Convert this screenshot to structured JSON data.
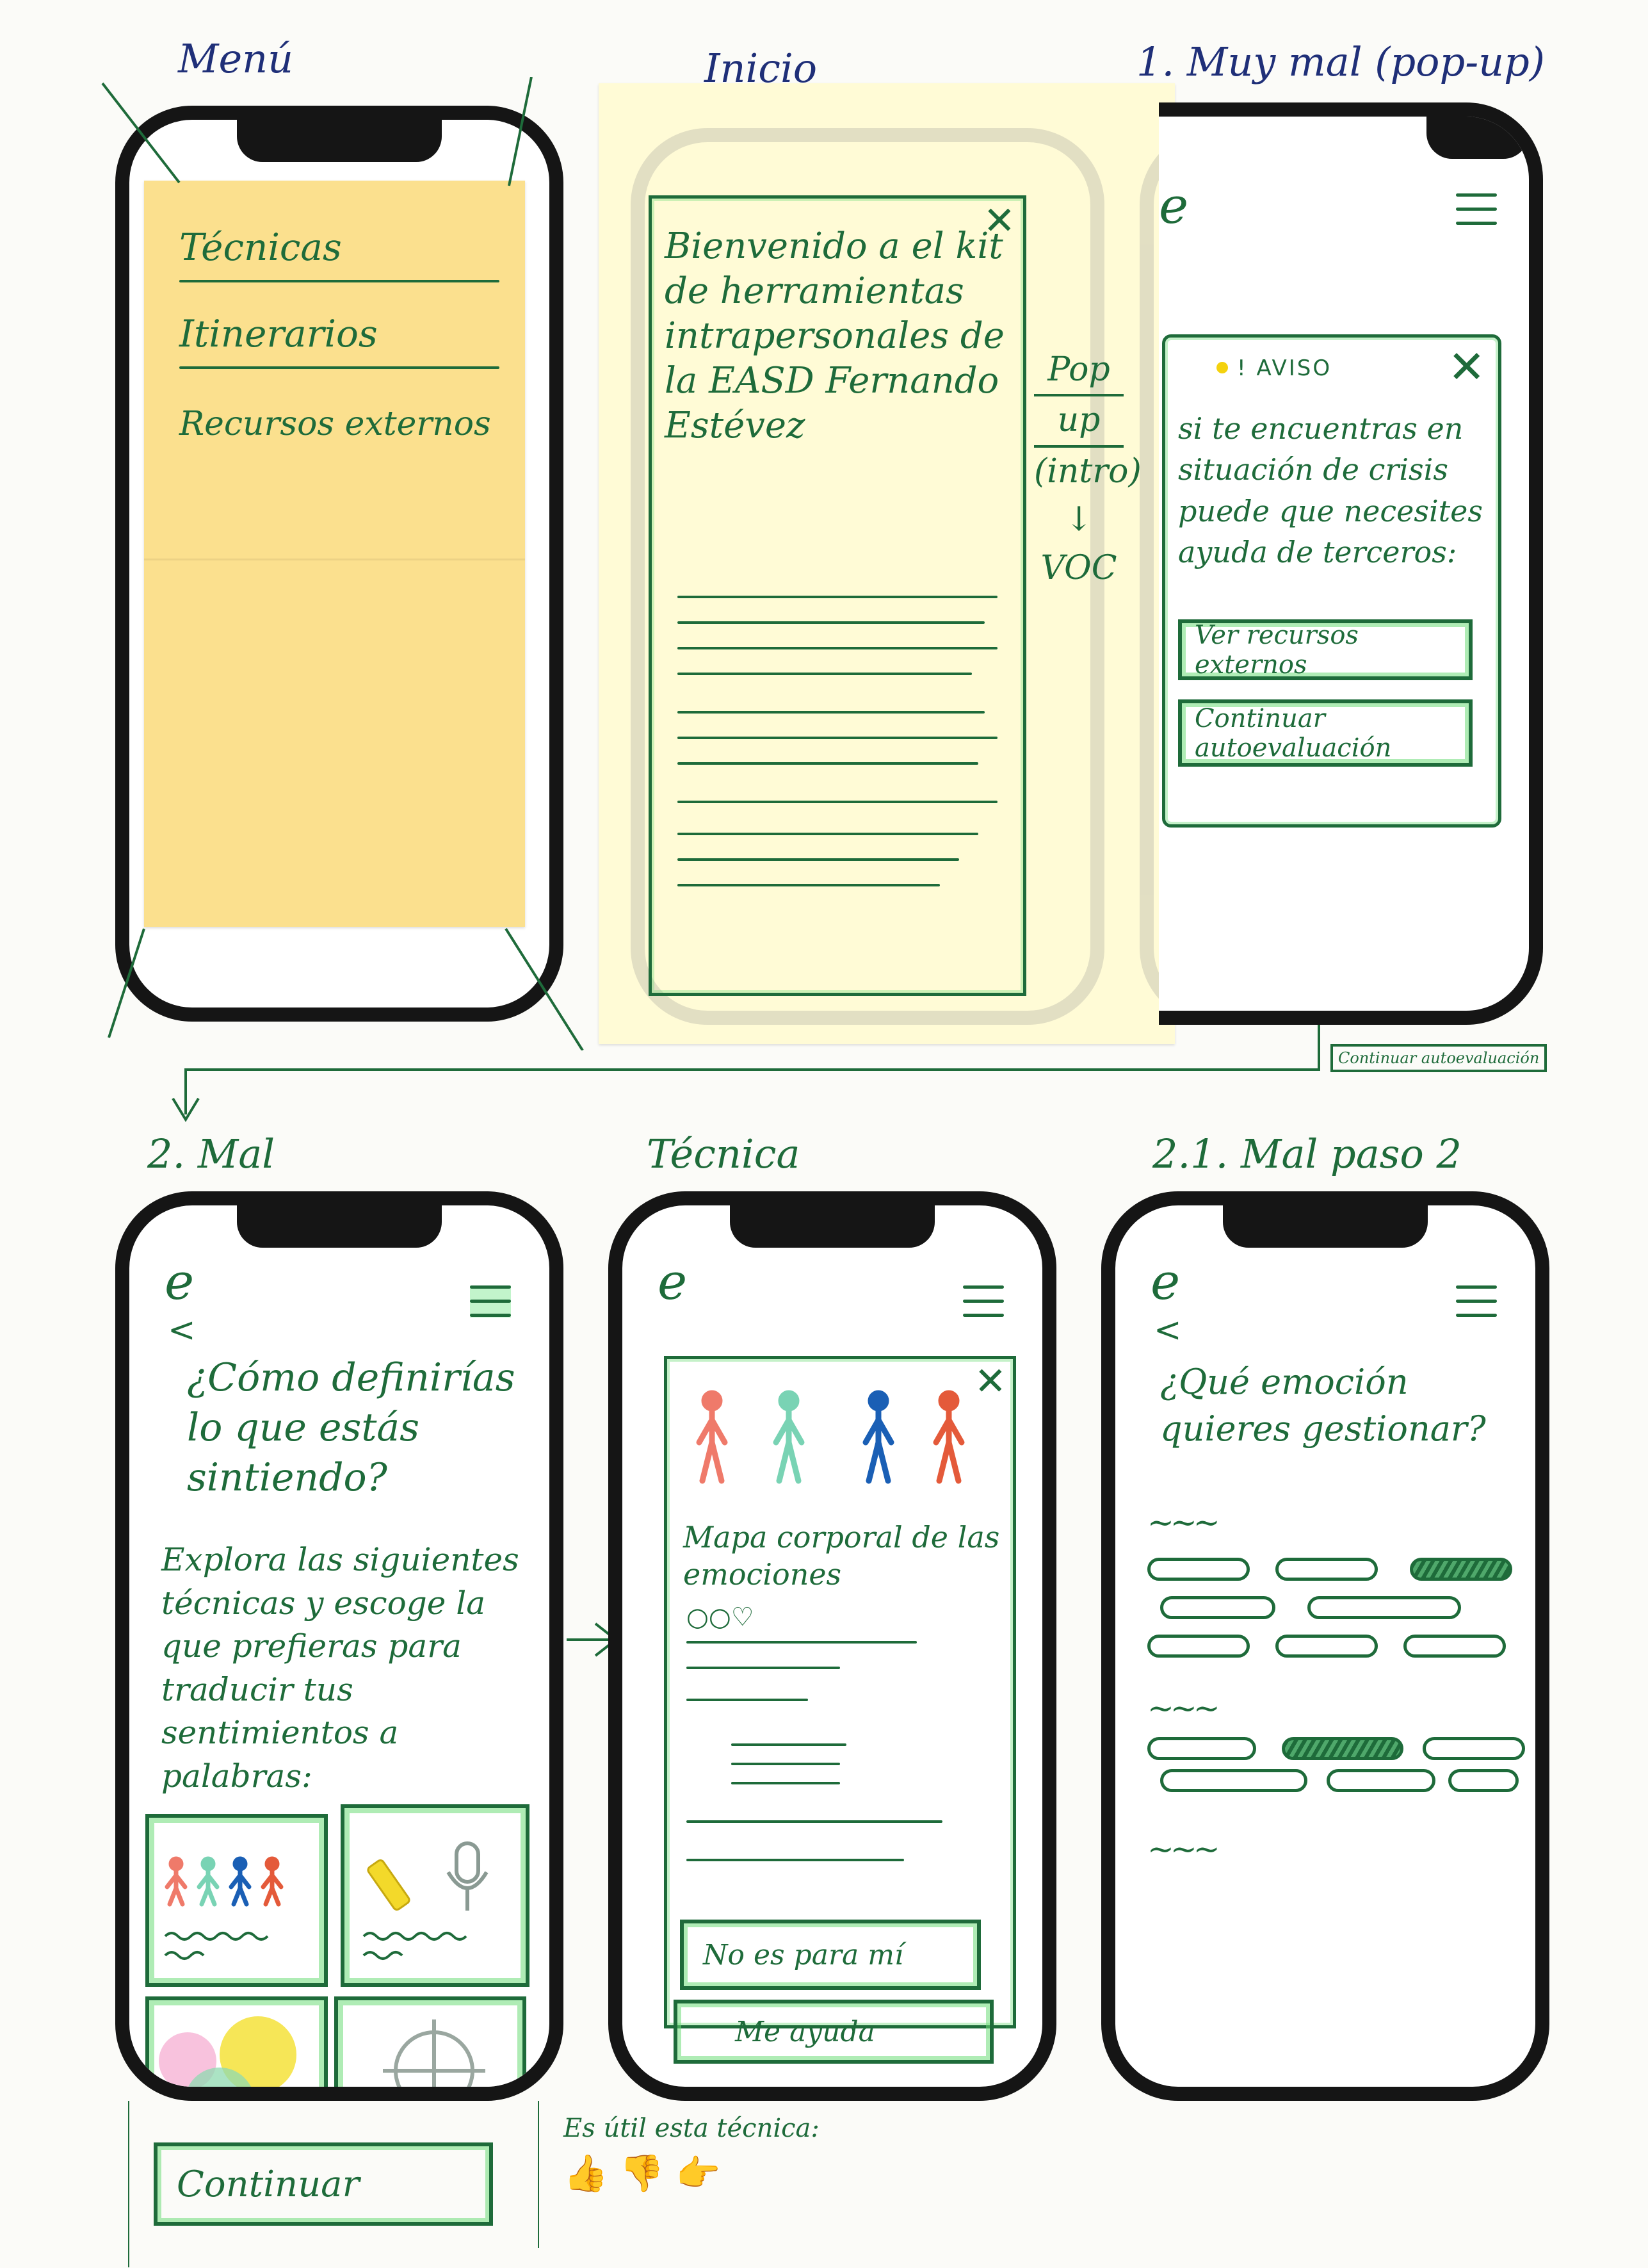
{
  "screens": {
    "menu": {
      "title": "Menú",
      "items": [
        "Técnicas",
        "Itinerarios",
        "Recursos externos"
      ]
    },
    "inicio": {
      "title": "Inicio",
      "popup_text": "Bienvenido a el kit de herramientas intrapersonales de la EASD Fernando Estévez",
      "side_note": [
        "Pop",
        "up",
        "(intro)",
        "↓",
        "VOC"
      ]
    },
    "muy_mal": {
      "title": "1. Muy mal (pop-up)",
      "logo": "e",
      "aviso_label": "! AVISO",
      "aviso_text": "si te encuentras en situación de crisis puede que necesites ayuda de terceros:",
      "btn_recursos": "Ver recursos externos",
      "btn_continuar": "Continuar autoevaluación",
      "flow_tag": "Continuar autoevaluación"
    },
    "mal": {
      "title": "2. Mal",
      "logo": "e",
      "back": "<",
      "question": "¿Cómo definirías lo que estás sintiendo?",
      "body": "Explora las siguientes técnicas y escoge la que prefieras para traducir tus sentimientos a palabras:",
      "continue_btn": "Continuar"
    },
    "tecnica": {
      "title": "Técnica",
      "logo": "e",
      "card_title": "Mapa corporal de las emociones",
      "rating": "○○♡",
      "btn_no": "No es para mí",
      "btn_yes": "Me ayuda",
      "feedback_label": "Es útil esta técnica:"
    },
    "mal_paso2": {
      "title": "2.1. Mal paso 2",
      "logo": "e",
      "back": "<",
      "question": "¿Qué emoción quieres gestionar?"
    }
  },
  "colors": {
    "ink_green": "#1e6b3a",
    "ink_navy": "#1f2f78",
    "highlight_green": "#7be38c",
    "sticky_yellow": "#fbe08e",
    "sticky_cream": "#fffbd6",
    "figure_red": "#ef7a6a",
    "figure_teal": "#79d3b4",
    "figure_blue": "#1a5fb5",
    "figure_orange": "#e45a3a"
  },
  "icons": [
    "hamburger-icon",
    "close-icon",
    "back-chevron-icon",
    "thumbs-up-icon",
    "thumbs-down-icon",
    "thumbs-sideways-icon",
    "pencil-icon",
    "microphone-icon",
    "compass-icon"
  ]
}
